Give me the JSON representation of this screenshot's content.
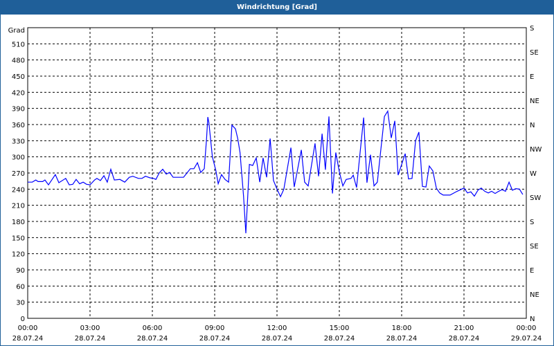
{
  "window": {
    "title": "Windrichtung [Grad]"
  },
  "chart_data": {
    "type": "line",
    "title": "Windrichtung [Grad]",
    "ylabel": "Grad",
    "ylim": [
      0,
      540
    ],
    "yticks": [
      0,
      30,
      60,
      90,
      120,
      150,
      180,
      210,
      240,
      270,
      300,
      330,
      360,
      390,
      420,
      450,
      480,
      510
    ],
    "y2_ticks": [
      {
        "value": 540,
        "label": "S"
      },
      {
        "value": 495,
        "label": "SE"
      },
      {
        "value": 450,
        "label": "E"
      },
      {
        "value": 405,
        "label": "NE"
      },
      {
        "value": 360,
        "label": "N"
      },
      {
        "value": 315,
        "label": "NW"
      },
      {
        "value": 270,
        "label": "W"
      },
      {
        "value": 225,
        "label": "SW"
      },
      {
        "value": 180,
        "label": "S"
      },
      {
        "value": 135,
        "label": "SE"
      },
      {
        "value": 90,
        "label": "E"
      },
      {
        "value": 45,
        "label": "NE"
      },
      {
        "value": 0,
        "label": "N"
      }
    ],
    "xlim_hours": [
      0,
      24
    ],
    "xticks": [
      {
        "hour": 0,
        "time": "00:00",
        "date": "28.07.24"
      },
      {
        "hour": 3,
        "time": "03:00",
        "date": "28.07.24"
      },
      {
        "hour": 6,
        "time": "06:00",
        "date": "28.07.24"
      },
      {
        "hour": 9,
        "time": "09:00",
        "date": "28.07.24"
      },
      {
        "hour": 12,
        "time": "12:00",
        "date": "28.07.24"
      },
      {
        "hour": 15,
        "time": "15:00",
        "date": "28.07.24"
      },
      {
        "hour": 18,
        "time": "18:00",
        "date": "28.07.24"
      },
      {
        "hour": 21,
        "time": "21:00",
        "date": "28.07.24"
      },
      {
        "hour": 24,
        "time": "00:00",
        "date": "29.07.24"
      }
    ],
    "grid": true,
    "line_color": "#0000ff",
    "series": [
      {
        "name": "Windrichtung",
        "points": [
          [
            0,
            253
          ],
          [
            0.22,
            253
          ],
          [
            0.39,
            257
          ],
          [
            0.5,
            254
          ],
          [
            0.72,
            254
          ],
          [
            0.83,
            257
          ],
          [
            1.0,
            248
          ],
          [
            1.33,
            267
          ],
          [
            1.5,
            252
          ],
          [
            1.83,
            260
          ],
          [
            2.0,
            248
          ],
          [
            2.17,
            249
          ],
          [
            2.33,
            258
          ],
          [
            2.5,
            250
          ],
          [
            2.67,
            253
          ],
          [
            2.83,
            249
          ],
          [
            3.0,
            248
          ],
          [
            3.22,
            257
          ],
          [
            3.33,
            260
          ],
          [
            3.5,
            256
          ],
          [
            3.67,
            265
          ],
          [
            3.83,
            253
          ],
          [
            4.0,
            277
          ],
          [
            4.17,
            257
          ],
          [
            4.44,
            258
          ],
          [
            4.67,
            253
          ],
          [
            4.89,
            262
          ],
          [
            5.06,
            264
          ],
          [
            5.33,
            260
          ],
          [
            5.5,
            260
          ],
          [
            5.67,
            264
          ],
          [
            5.89,
            261
          ],
          [
            6.06,
            260
          ],
          [
            6.17,
            258
          ],
          [
            6.33,
            270
          ],
          [
            6.5,
            277
          ],
          [
            6.67,
            268
          ],
          [
            6.83,
            271
          ],
          [
            7.0,
            262
          ],
          [
            7.5,
            262
          ],
          [
            7.83,
            278
          ],
          [
            8.0,
            278
          ],
          [
            8.17,
            289
          ],
          [
            8.33,
            271
          ],
          [
            8.5,
            278
          ],
          [
            8.61,
            334
          ],
          [
            8.67,
            374
          ],
          [
            8.72,
            364
          ],
          [
            8.89,
            300
          ],
          [
            9.06,
            274
          ],
          [
            9.17,
            250
          ],
          [
            9.33,
            267
          ],
          [
            9.5,
            258
          ],
          [
            9.67,
            253
          ],
          [
            9.83,
            359
          ],
          [
            10.0,
            352
          ],
          [
            10.11,
            334
          ],
          [
            10.22,
            308
          ],
          [
            10.39,
            227
          ],
          [
            10.5,
            158
          ],
          [
            10.67,
            286
          ],
          [
            10.83,
            284
          ],
          [
            11.0,
            298
          ],
          [
            11.17,
            253
          ],
          [
            11.33,
            298
          ],
          [
            11.5,
            262
          ],
          [
            11.67,
            334
          ],
          [
            11.83,
            256
          ],
          [
            12.0,
            240
          ],
          [
            12.17,
            226
          ],
          [
            12.33,
            240
          ],
          [
            12.67,
            317
          ],
          [
            12.83,
            244
          ],
          [
            13.17,
            313
          ],
          [
            13.33,
            253
          ],
          [
            13.5,
            246
          ],
          [
            13.83,
            325
          ],
          [
            14.0,
            264
          ],
          [
            14.17,
            343
          ],
          [
            14.33,
            276
          ],
          [
            14.5,
            375
          ],
          [
            14.67,
            232
          ],
          [
            14.83,
            308
          ],
          [
            15.0,
            272
          ],
          [
            15.17,
            246
          ],
          [
            15.33,
            258
          ],
          [
            15.56,
            260
          ],
          [
            15.67,
            266
          ],
          [
            15.83,
            243
          ],
          [
            16.17,
            373
          ],
          [
            16.33,
            252
          ],
          [
            16.5,
            304
          ],
          [
            16.67,
            246
          ],
          [
            16.83,
            253
          ],
          [
            17.17,
            375
          ],
          [
            17.33,
            385
          ],
          [
            17.5,
            335
          ],
          [
            17.67,
            367
          ],
          [
            17.83,
            266
          ],
          [
            18.17,
            306
          ],
          [
            18.33,
            259
          ],
          [
            18.5,
            260
          ],
          [
            18.67,
            330
          ],
          [
            18.83,
            346
          ],
          [
            19.0,
            245
          ],
          [
            19.17,
            244
          ],
          [
            19.33,
            283
          ],
          [
            19.5,
            274
          ],
          [
            19.67,
            242
          ],
          [
            19.83,
            233
          ],
          [
            20.0,
            229
          ],
          [
            20.33,
            229
          ],
          [
            20.67,
            236
          ],
          [
            21.0,
            242
          ],
          [
            21.17,
            233
          ],
          [
            21.33,
            235
          ],
          [
            21.5,
            227
          ],
          [
            21.67,
            238
          ],
          [
            21.83,
            242
          ],
          [
            22.0,
            236
          ],
          [
            22.17,
            233
          ],
          [
            22.33,
            236
          ],
          [
            22.5,
            232
          ],
          [
            22.67,
            236
          ],
          [
            22.83,
            239
          ],
          [
            23.0,
            236
          ],
          [
            23.17,
            253
          ],
          [
            23.33,
            238
          ],
          [
            23.5,
            241
          ],
          [
            23.67,
            240
          ],
          [
            23.83,
            230
          ]
        ]
      }
    ]
  }
}
